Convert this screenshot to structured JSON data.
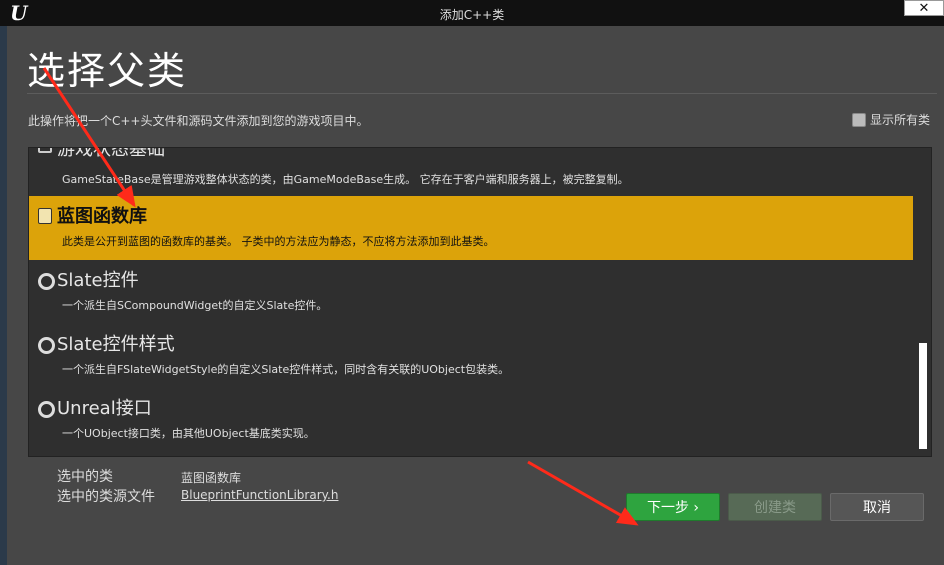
{
  "window": {
    "title": "添加C++类",
    "logo": "U",
    "close_label": "✕"
  },
  "page": {
    "heading": "选择父类",
    "description": "此操作将把一个C++头文件和源码文件添加到您的游戏项目中。",
    "show_all_label": "显示所有类"
  },
  "classes": [
    {
      "title": "游戏状态基础",
      "description": "GameStateBase是管理游戏整体状态的类，由GameModeBase生成。 它存在于客户端和服务器上，被完整复制。"
    },
    {
      "title": "蓝图函数库",
      "description": "此类是公开到蓝图的函数库的基类。 子类中的方法应为静态，不应将方法添加到此基类。",
      "selected": true
    },
    {
      "title": "Slate控件",
      "description": "一个派生自SCompoundWidget的自定义Slate控件。"
    },
    {
      "title": "Slate控件样式",
      "description": "一个派生自FSlateWidgetStyle的自定义Slate控件样式，同时含有关联的UObject包装类。"
    },
    {
      "title": "Unreal接口",
      "description": "一个UObject接口类，由其他UObject基底类实现。"
    }
  ],
  "selection": {
    "class_label": "选中的类",
    "class_value": "蓝图函数库",
    "file_label": "选中的类源文件",
    "file_value": "BlueprintFunctionLibrary.h"
  },
  "buttons": {
    "next": "下一步 ›",
    "create": "创建类",
    "cancel": "取消"
  },
  "colors": {
    "selected_row": "#dca30a",
    "next_button": "#2ea43f",
    "annotation_arrow": "#ff2a1a"
  }
}
